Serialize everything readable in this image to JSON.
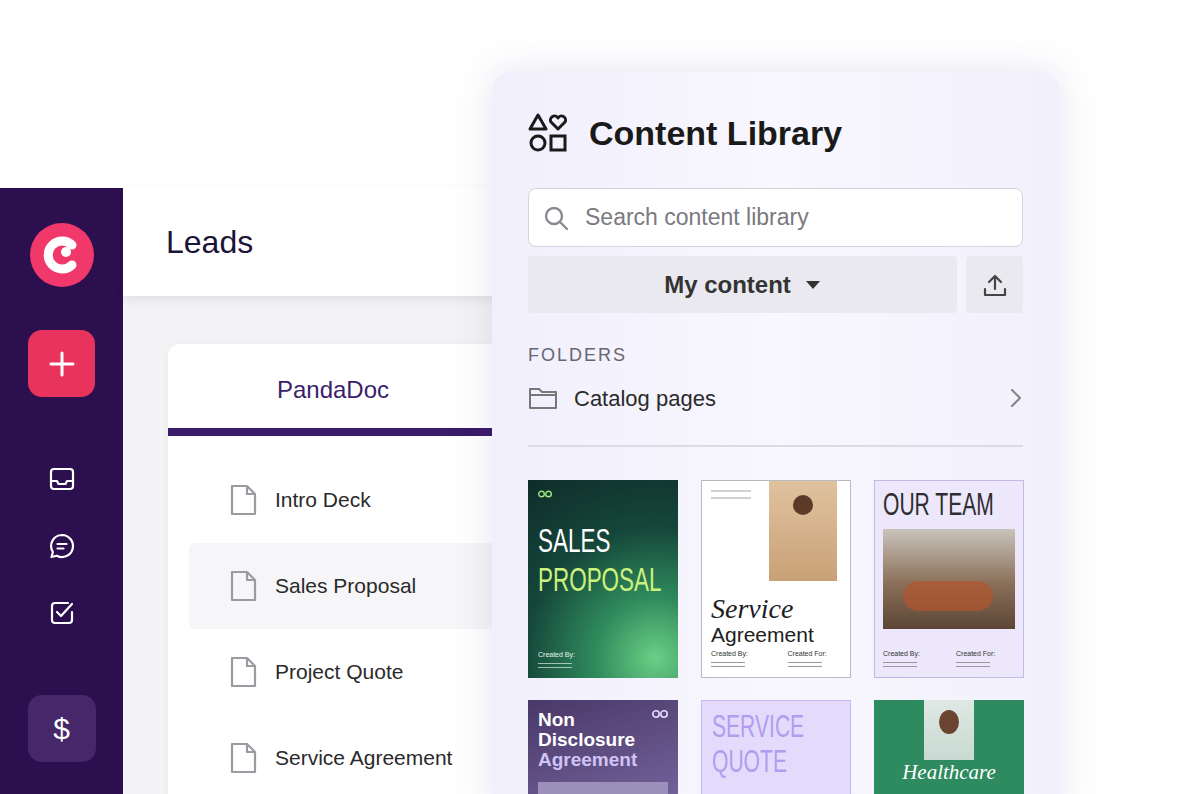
{
  "sidebar": {
    "money_button": "$"
  },
  "leads": {
    "title": "Leads",
    "tabs": [
      {
        "label": "PandaDoc",
        "selected": true
      }
    ],
    "documents": [
      {
        "name": "Intro Deck",
        "selected": false
      },
      {
        "name": "Sales Proposal",
        "selected": true
      },
      {
        "name": "Project Quote",
        "selected": false
      },
      {
        "name": "Service Agreement",
        "selected": false
      }
    ]
  },
  "content_library": {
    "title": "Content Library",
    "search": {
      "placeholder": "Search content library"
    },
    "filter": {
      "label": "My content"
    },
    "folders_heading": "FOLDERS",
    "folders": [
      {
        "name": "Catalog pages"
      }
    ],
    "templates": [
      {
        "kind": "dark",
        "title": [
          "SALES",
          "PROPOSAL"
        ],
        "footer": [
          "Created By:"
        ]
      },
      {
        "kind": "split",
        "title": [
          "Service",
          "Agreement"
        ],
        "footer": [
          "Created By:",
          "Created For:"
        ]
      },
      {
        "kind": "photo",
        "title": [
          "OUR TEAM"
        ],
        "footer": [
          "Created By:",
          "Created For:"
        ]
      },
      {
        "kind": "banner",
        "title": [
          "Non",
          "Disclosure",
          "Agreement"
        ],
        "footer": []
      },
      {
        "kind": "light",
        "title": [
          "SERVICE",
          "QUOTE"
        ],
        "footer": []
      },
      {
        "kind": "portrait",
        "title": [
          "Healthcare"
        ],
        "footer": []
      }
    ]
  }
}
